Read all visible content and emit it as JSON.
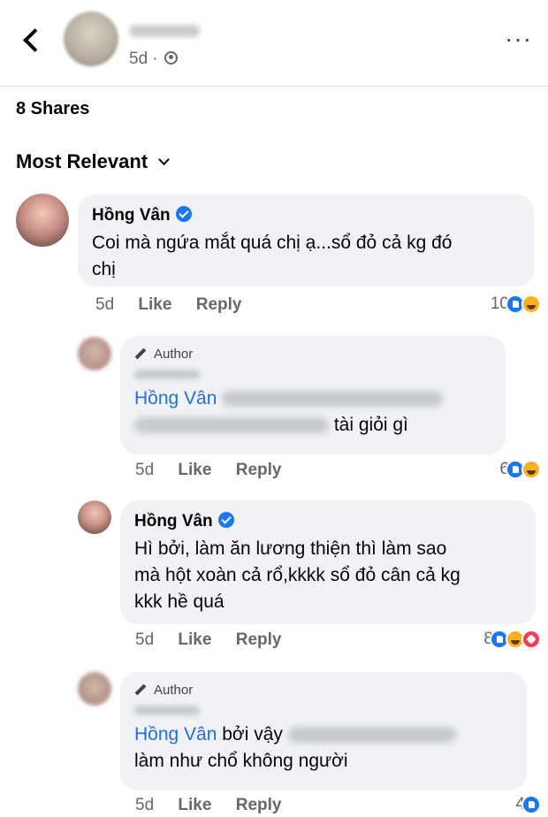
{
  "header": {
    "back_icon": "chevron-left-icon",
    "poster_meta": "5d ·",
    "privacy_icon": "globe-icon",
    "more_icon": "more-horizontal-icon"
  },
  "shares_label": "8 Shares",
  "sort": {
    "label": "Most Relevant",
    "icon": "chevron-down-icon"
  },
  "comments": [
    {
      "name": "Hồng Vân",
      "verified": true,
      "lines": [
        "Coi mà ngứa mắt quá chị ạ...sổ đỏ cả kg đó",
        "chị"
      ],
      "time": "5d",
      "like": "Like",
      "reply": "Reply",
      "reaction_count": "10",
      "reactions": [
        "like",
        "haha"
      ]
    },
    {
      "badge": "Author",
      "mention": "Hồng Vân",
      "visible_text": "tài giỏi gì",
      "time": "5d",
      "like": "Like",
      "reply": "Reply",
      "reaction_count": "6",
      "reactions": [
        "like",
        "haha"
      ]
    },
    {
      "name": "Hồng Vân",
      "verified": true,
      "lines": [
        "Hì bởi, làm ăn lương thiện thì làm sao",
        "mà hột xoàn cả rổ,kkkk sổ đỏ cân cả kg",
        "kkk hề quá"
      ],
      "time": "5d",
      "like": "Like",
      "reply": "Reply",
      "reaction_count": "8",
      "reactions": [
        "like",
        "haha",
        "love"
      ]
    },
    {
      "badge": "Author",
      "mention": "Hồng Vân",
      "text_after_mention": "bởi vậy",
      "line2": "làm như chổ không người",
      "time": "5d",
      "like": "Like",
      "reply": "Reply",
      "reaction_count": "4",
      "reactions": [
        "like"
      ]
    }
  ],
  "colors": {
    "link": "#216fdb",
    "bubble": "#f0f2f5",
    "meta": "#65676b",
    "like": "#1877f2",
    "haha": "#f7b125",
    "love": "#f33e58"
  }
}
